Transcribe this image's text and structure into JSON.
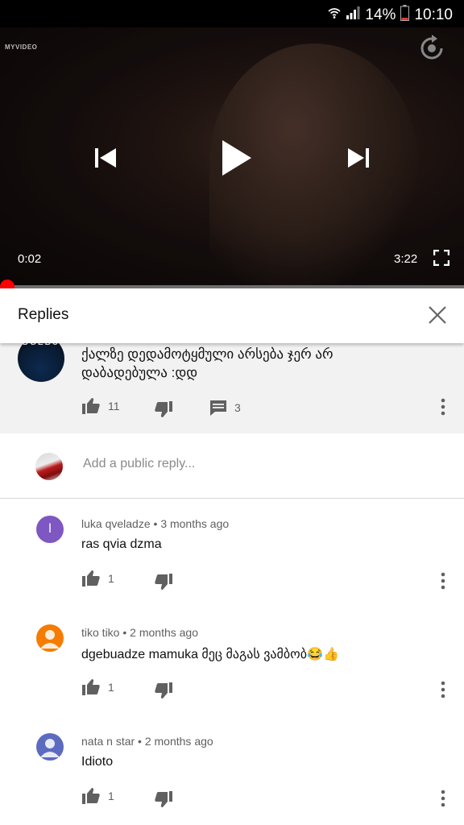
{
  "status_bar": {
    "battery": "14%",
    "time": "10:10"
  },
  "player": {
    "logo": "MYVIDEO",
    "current_time": "0:02",
    "duration": "3:22",
    "progress_fraction": 0.01
  },
  "replies_panel": {
    "title": "Replies"
  },
  "parent_comment": {
    "avatar_text": "DGEBU",
    "text": "ქალზე დედამოტყმული არსება ჯერ არ დაბადებულა :დდ",
    "likes": "11",
    "replies": "3"
  },
  "reply_box": {
    "placeholder": "Add a public reply..."
  },
  "comments": [
    {
      "author": "luka qveladze",
      "time": "3 months ago",
      "text": "ras qvia dzma",
      "likes": "1",
      "avatar_letter": "l",
      "avatar_color": "#7e57c2"
    },
    {
      "author": "tiko tiko",
      "time": "2 months ago",
      "text": "dgebuadze mamuka მეც მაგას ვამბობ😂👍",
      "likes": "1",
      "avatar_color": "#f57c00"
    },
    {
      "author": "nata n star",
      "time": "2 months ago",
      "text": "Idioto",
      "likes": "1",
      "avatar_color": "#5c6bc0"
    }
  ]
}
